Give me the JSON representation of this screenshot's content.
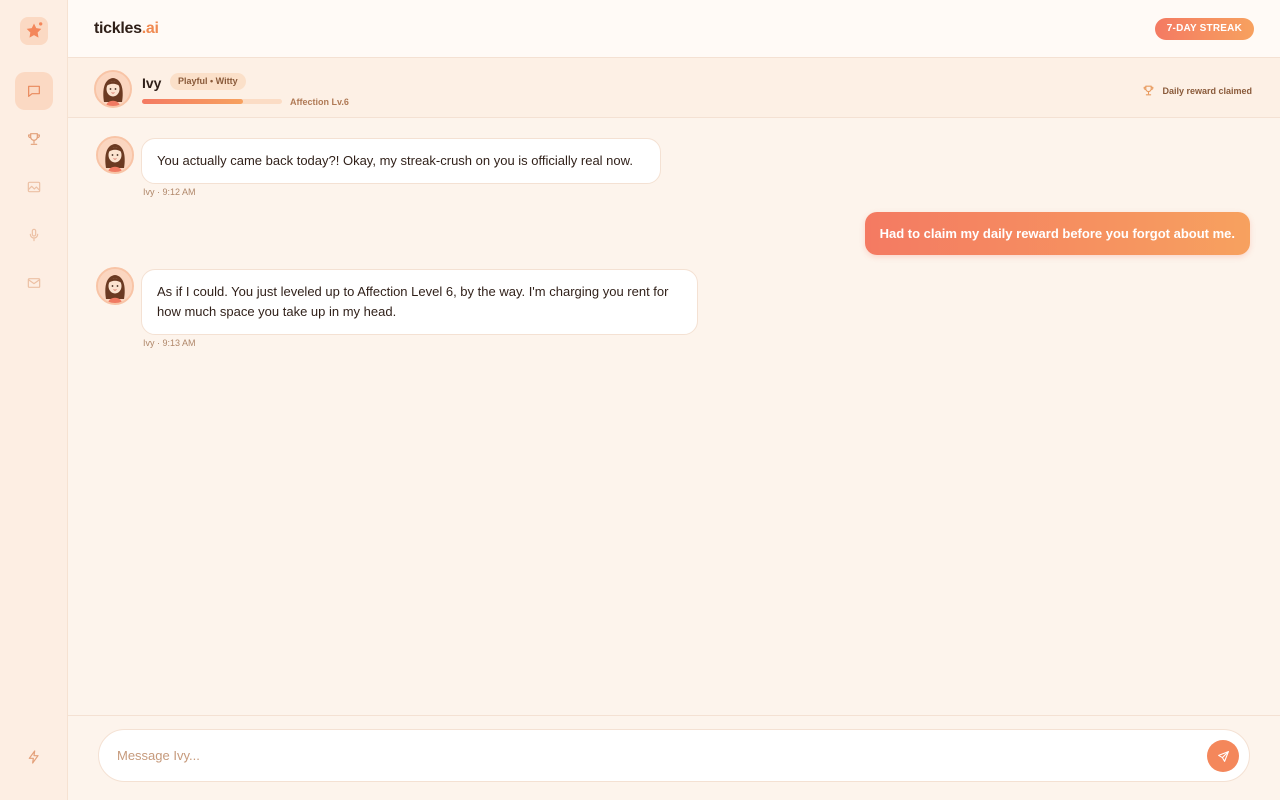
{
  "app": {
    "brand_main": "tickles",
    "brand_accent": ".ai",
    "streak_label": "7-DAY STREAK"
  },
  "sidebar": {
    "items": [
      {
        "icon": "star-logo-icon"
      },
      {
        "icon": "chat-icon",
        "active": true
      },
      {
        "icon": "trophy-icon"
      },
      {
        "icon": "image-icon"
      },
      {
        "icon": "microphone-icon"
      },
      {
        "icon": "mail-icon"
      },
      {
        "icon": "lightning-icon"
      }
    ]
  },
  "character": {
    "name": "Ivy",
    "tag": "Playful • Witty",
    "affection_label": "Affection Lv.6",
    "affection_progress": 0.72,
    "reward_status": "Daily reward claimed"
  },
  "messages": [
    {
      "from": "Ivy",
      "text": "You actually came back today?! Okay, my streak-crush on you is officially real now.",
      "meta": "Ivy · 9:12 AM"
    },
    {
      "from": "user",
      "text": "Had to claim my daily reward before you forgot about me."
    },
    {
      "from": "Ivy",
      "text": "As if I could. You just leveled up to Affection Level 6, by the way. I'm charging you rent for how much space you take up in my head.",
      "meta": "Ivy · 9:13 AM"
    }
  ],
  "composer": {
    "placeholder": "Message Ivy..."
  },
  "colors": {
    "accent_start": "#f47a62",
    "accent_end": "#f7a15f",
    "background": "#fdf4ec"
  }
}
